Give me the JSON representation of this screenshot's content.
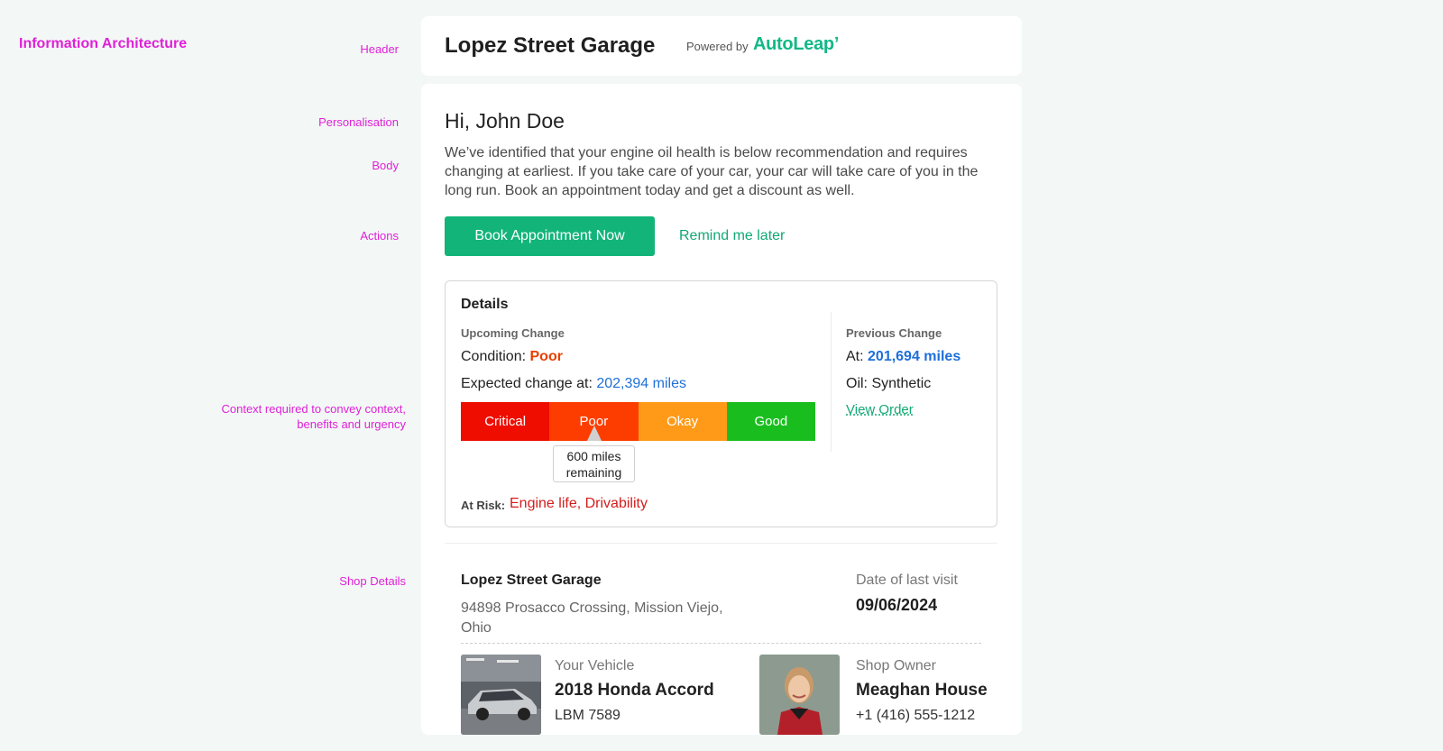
{
  "annotations": {
    "title": "Information Architecture",
    "header": "Header",
    "personalisation": "Personalisation",
    "body": "Body",
    "actions": "Actions",
    "context_line1": "Context required to convey context,",
    "context_line2": "benefits and urgency",
    "shop_details": "Shop Details"
  },
  "header": {
    "shop_name": "Lopez Street Garage",
    "powered_by": "Powered by",
    "brand": "AutoLeapʼ"
  },
  "greeting": "Hi, John Doe",
  "message": "We’ve identified that your engine oil health is below recommendation and requires changing at earliest. If you take care of your car, your car will take care of you in the long run. Book an appointment today and get a discount as well.",
  "actions": {
    "book": "Book Appointment Now",
    "remind": "Remind me later"
  },
  "details": {
    "title": "Details",
    "upcoming": {
      "heading": "Upcoming Change",
      "condition_label": "Condition:",
      "condition_value": "Poor",
      "expected_label": "Expected change at:",
      "expected_value": "202,394 miles"
    },
    "gauge": {
      "segments": [
        "Critical",
        "Poor",
        "Okay",
        "Good"
      ],
      "colors": [
        "#ef0d00",
        "#fd3d00",
        "#ff9a18",
        "#19be1e"
      ],
      "current": "Poor",
      "tooltip_line1": "600 miles",
      "tooltip_line2": "remaining"
    },
    "at_risk_label": "At Risk:",
    "at_risk_value": "Engine life, Drivability",
    "previous": {
      "heading": "Previous Change",
      "at_label": "At:",
      "at_value": "201,694 miles",
      "oil": "Oil: Synthetic",
      "view_order": "View Order"
    }
  },
  "shop": {
    "name": "Lopez Street Garage",
    "address": "94898 Prosacco Crossing, Mission Viejo, Ohio",
    "last_visit_label": "Date of last visit",
    "last_visit": "09/06/2024",
    "vehicle_label": "Your Vehicle",
    "vehicle": "2018 Honda Accord",
    "plate": "LBM 7589",
    "owner_label": "Shop Owner",
    "owner": "Meaghan House",
    "phone": "+1 (416) 555-1212"
  }
}
